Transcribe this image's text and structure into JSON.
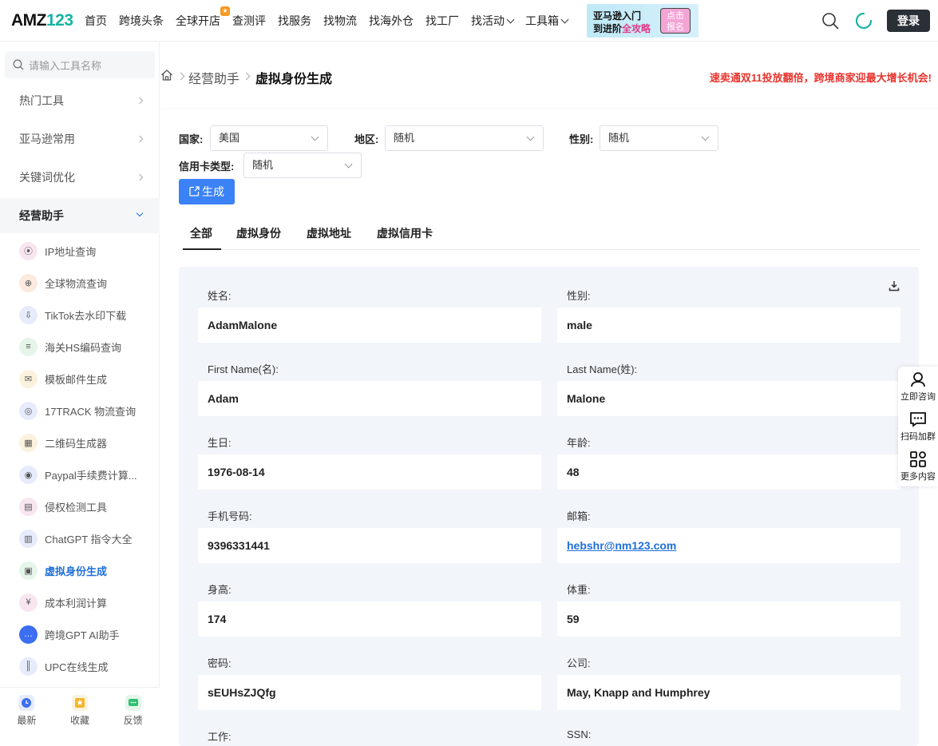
{
  "header": {
    "logo": {
      "text": "AMZ",
      "num": "123"
    },
    "nav": [
      {
        "label": "首页",
        "caret": false
      },
      {
        "label": "跨境头条",
        "caret": false
      },
      {
        "label": "全球开店",
        "caret": false,
        "badge": true
      },
      {
        "label": "查测评",
        "caret": false
      },
      {
        "label": "找服务",
        "caret": false
      },
      {
        "label": "找物流",
        "caret": false
      },
      {
        "label": "找海外仓",
        "caret": false
      },
      {
        "label": "找工厂",
        "caret": false
      },
      {
        "label": "找活动",
        "caret": true
      },
      {
        "label": "工具箱",
        "caret": true
      }
    ],
    "banner": {
      "line1": "亚马逊入门",
      "line2a": "到进阶",
      "line2b": "全攻略",
      "btn1": "点击",
      "btn2": "报名"
    },
    "login": "登录"
  },
  "sidebar": {
    "search_placeholder": "请输入工具名称",
    "categories": [
      "热门工具",
      "亚马逊常用",
      "关键词优化",
      "经营助手"
    ],
    "tools": [
      {
        "label": "IP地址查询",
        "icon": "location-pin-icon",
        "color": "#f7e6f0"
      },
      {
        "label": "全球物流查询",
        "icon": "globe-icon",
        "color": "#fbeadd"
      },
      {
        "label": "TikTok去水印下载",
        "icon": "download-icon",
        "color": "#e6ecfb"
      },
      {
        "label": "海关HS编码查询",
        "icon": "list-search-icon",
        "color": "#e5f5ea"
      },
      {
        "label": "模板邮件生成",
        "icon": "mail-icon",
        "color": "#fbf2dd"
      },
      {
        "label": "17TRACK 物流查询",
        "icon": "track-icon",
        "color": "#e6ecfb"
      },
      {
        "label": "二维码生成器",
        "icon": "qrcode-icon",
        "color": "#fbf2dd"
      },
      {
        "label": "Paypal手续费计算...",
        "icon": "coins-icon",
        "color": "#e6ecfb"
      },
      {
        "label": "侵权检测工具",
        "icon": "document-check-icon",
        "color": "#f7e6f0"
      },
      {
        "label": "ChatGPT 指令大全",
        "icon": "book-icon",
        "color": "#e6ecfb"
      },
      {
        "label": "虚拟身份生成",
        "icon": "id-card-icon",
        "color": "#e5f5ea",
        "active": true
      },
      {
        "label": "成本利润计算",
        "icon": "yen-percent-icon",
        "color": "#f7e6f0"
      },
      {
        "label": "跨境GPT AI助手",
        "icon": "chat-bubble-icon",
        "color": "#3b6ef0"
      },
      {
        "label": "UPC在线生成",
        "icon": "barcode-icon",
        "color": "#e6ecfb"
      }
    ],
    "bottom": [
      "最新",
      "收藏",
      "反馈"
    ]
  },
  "breadcrumb": {
    "parent": "经营助手",
    "current": "虚拟身份生成",
    "promo": "速卖通双11投放翻倍，跨境商家迎最大增长机会!"
  },
  "form": {
    "country_label": "国家:",
    "country_value": "美国",
    "region_label": "地区:",
    "region_value": "随机",
    "gender_label": "性别:",
    "gender_value": "随机",
    "card_label": "信用卡类型:",
    "card_value": "随机",
    "generate": "生成"
  },
  "tabs": [
    "全部",
    "虚拟身份",
    "虚拟地址",
    "虚拟信用卡"
  ],
  "fields": [
    {
      "label": "姓名:",
      "value": "AdamMalone"
    },
    {
      "label": "性别:",
      "value": "male"
    },
    {
      "label": "First Name(名):",
      "value": "Adam"
    },
    {
      "label": "Last Name(姓):",
      "value": "Malone"
    },
    {
      "label": "生日:",
      "value": "1976-08-14"
    },
    {
      "label": "年龄:",
      "value": "48"
    },
    {
      "label": "手机号码:",
      "value": "9396331441"
    },
    {
      "label": "邮箱:",
      "value": "hebshr@nm123.com",
      "link": true
    },
    {
      "label": "身高:",
      "value": "174"
    },
    {
      "label": "体重:",
      "value": "59"
    },
    {
      "label": "密码:",
      "value": "sEUHsZJQfg"
    },
    {
      "label": "公司:",
      "value": "May, Knapp and Humphrey"
    },
    {
      "label": "工作:",
      "value": ""
    },
    {
      "label": "SSN:",
      "value": ""
    }
  ],
  "float": [
    "立即咨询",
    "扫码加群",
    "更多内容"
  ],
  "colors": {
    "brand": "#17b3a3",
    "primary": "#3b82f6",
    "promo": "#e8342d",
    "panel": "#f2f5fa"
  }
}
